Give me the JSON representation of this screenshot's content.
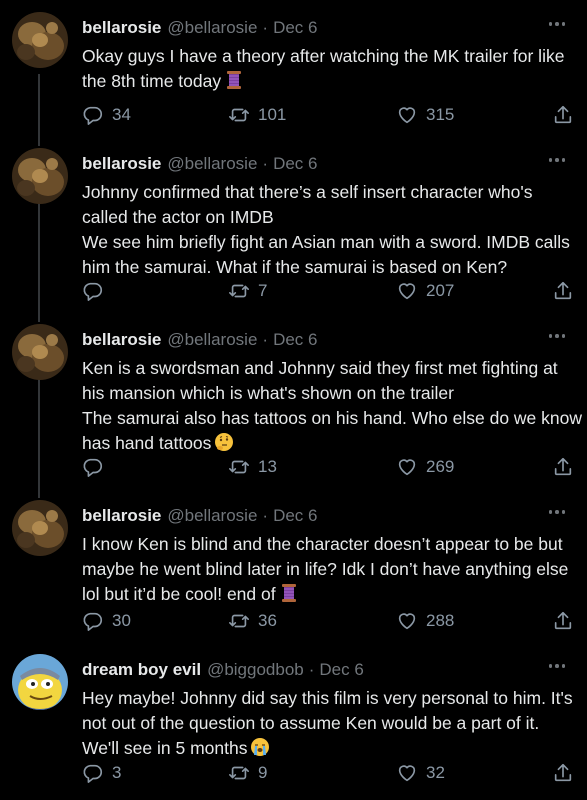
{
  "tweets": [
    {
      "name": "bellarosie",
      "handle": "@bellarosie",
      "date": "Dec 6",
      "lines": [
        "Okay guys I have a theory after watching the MK trailer for like",
        "the 8th time today"
      ],
      "emoji": "thread-spool",
      "replies": "34",
      "retweets": "101",
      "likes": "315"
    },
    {
      "name": "bellarosie",
      "handle": "@bellarosie",
      "date": "Dec 6",
      "lines": [
        "Johnny confirmed that there’s a self insert character who's",
        "called the actor on IMDB",
        "We see him briefly fight an Asian man with a sword. IMDB calls",
        "him the samurai. What if the samurai is based on Ken?"
      ],
      "replies": "",
      "retweets": "7",
      "likes": "207"
    },
    {
      "name": "bellarosie",
      "handle": "@bellarosie",
      "date": "Dec 6",
      "lines": [
        "Ken is a swordsman and Johnny said they first met fighting at",
        "his mansion which is what's shown on the trailer",
        "The samurai also has tattoos on his hand. Who else do we know",
        "has hand tattoos"
      ],
      "emoji": "thinking-face",
      "replies": "",
      "retweets": "13",
      "likes": "269"
    },
    {
      "name": "bellarosie",
      "handle": "@bellarosie",
      "date": "Dec 6",
      "lines": [
        "I know Ken is blind and the character doesn’t appear to be but",
        "maybe he went blind later in life? Idk I don’t have anything else",
        "lol but it’d be cool! end of"
      ],
      "emoji": "thread-spool",
      "replies": "30",
      "retweets": "36",
      "likes": "288"
    },
    {
      "name": "dream boy evil",
      "handle": "@biggodbob",
      "date": "Dec 6",
      "lines": [
        "Hey maybe! Johnny did say this film is very personal to him. It's",
        "not out of the question to assume Ken would be a part of it.",
        "We'll see in 5 months"
      ],
      "emoji": "loudly-crying-face",
      "replies": "3",
      "retweets": "9",
      "likes": "32"
    }
  ],
  "icons": {
    "reply": "reply-icon",
    "retweet": "retweet-icon",
    "like": "heart-icon",
    "share": "share-icon",
    "more": "more-icon"
  },
  "colors": {
    "background": "#000000",
    "text": "#e7e9ea",
    "muted": "#71767b",
    "thread_line": "#333639"
  }
}
